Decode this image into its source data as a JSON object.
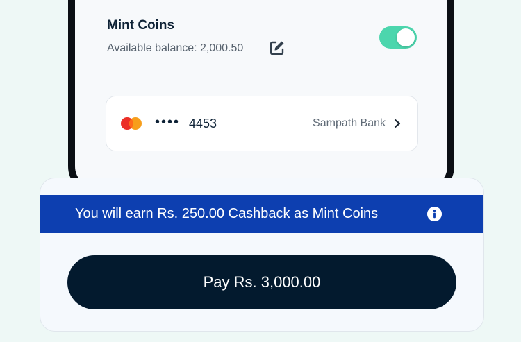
{
  "mint_coins": {
    "title": "Mint Coins",
    "balance_text": "Available balance: 2,000.50",
    "toggle_on": true,
    "toggle_color": "#4cd6ad",
    "edit_icon": "edit-icon"
  },
  "card": {
    "masked": "••••",
    "last4": "4453",
    "bank": "Sampath Bank",
    "brand_icon": "mastercard-icon",
    "chevron_icon": "chevron-right-icon"
  },
  "cashback": {
    "text": "You will earn Rs. 250.00 Cashback as Mint Coins",
    "background": "#0d3fb0",
    "info_icon": "info-icon"
  },
  "pay": {
    "label": "Pay Rs. 3,000.00",
    "background": "#031a2e"
  }
}
